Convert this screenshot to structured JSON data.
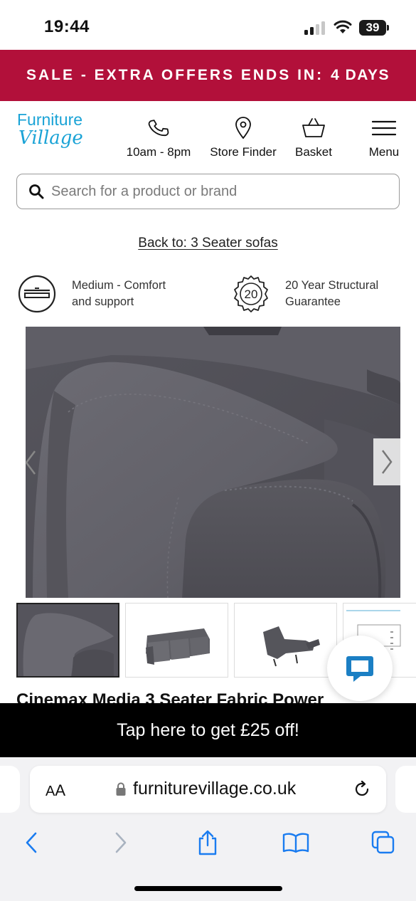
{
  "status_bar": {
    "time": "19:44",
    "battery": "39",
    "icons": [
      "cellular-signal-icon",
      "wifi-icon",
      "battery-icon"
    ]
  },
  "sale_banner": {
    "text": "SALE - EXTRA OFFERS ENDS IN:",
    "days": "4 DAYS",
    "background": "#b2103a"
  },
  "header": {
    "logo_line1": "Furniture",
    "logo_line2": "Village",
    "brand_color": "#1aa3d6",
    "nav": [
      {
        "label": "10am - 8pm",
        "icon": "phone-icon"
      },
      {
        "label": "Store Finder",
        "icon": "location-pin-icon"
      },
      {
        "label": "Basket",
        "icon": "basket-icon"
      },
      {
        "label": "Menu",
        "icon": "hamburger-menu-icon"
      }
    ]
  },
  "search": {
    "placeholder": "Search for a product or brand",
    "value": ""
  },
  "back_link": "Back to: 3 Seater sofas",
  "features": [
    {
      "line1": "Medium - Comfort",
      "line2": "and support",
      "icon": "comfort-seat-icon"
    },
    {
      "badge": "20",
      "line1": "20 Year Structural",
      "line2": "Guarantee",
      "icon": "guarantee-badge-icon"
    }
  ],
  "gallery": {
    "thumbnail_count": 4,
    "active_index": 0
  },
  "product": {
    "title": "Cinemax Media 3 Seater Fabric Power"
  },
  "promo_bar": {
    "text": "Tap here to get £25 off!"
  },
  "browser": {
    "text_size_label_small": "A",
    "text_size_label_big": "A",
    "url": "furniturevillage.co.uk"
  }
}
